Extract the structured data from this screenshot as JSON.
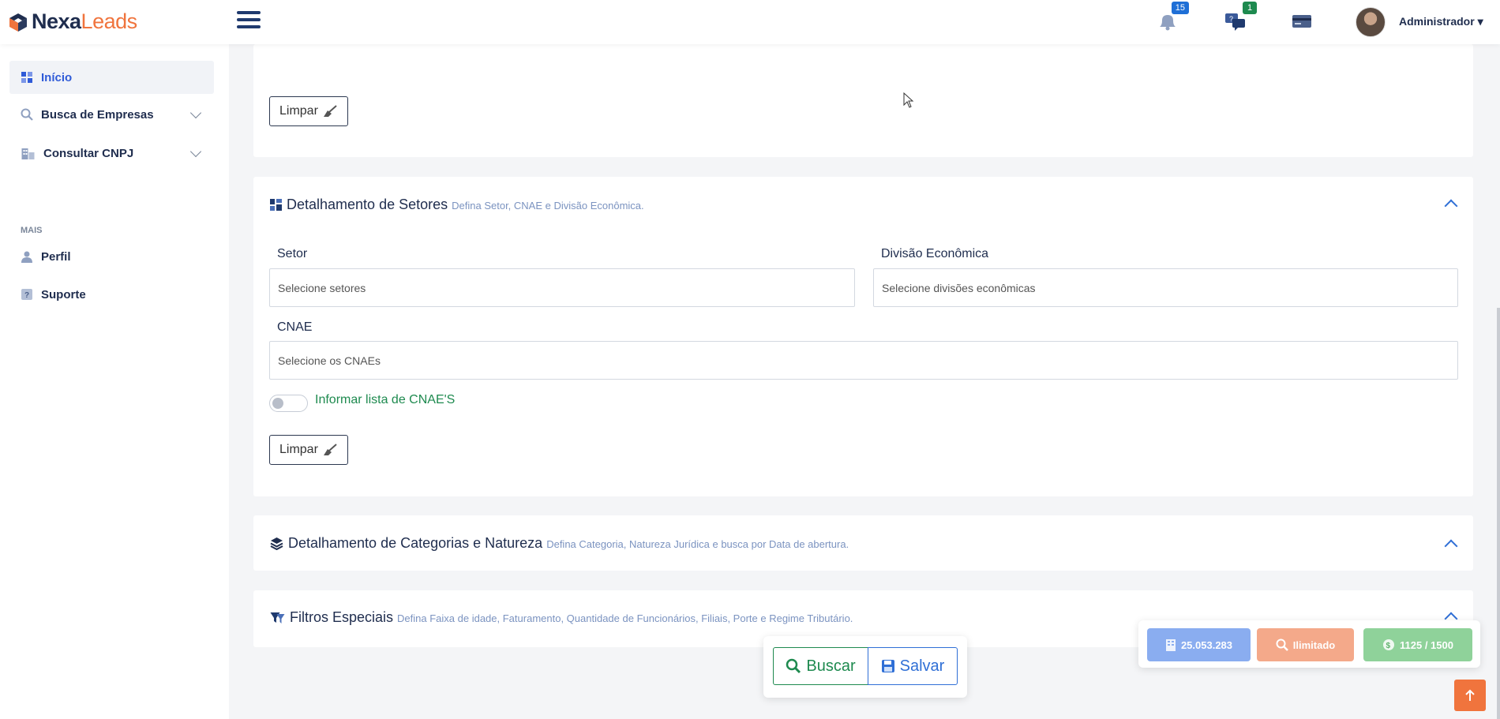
{
  "app": {
    "logo_a": "Nexa",
    "logo_b": "Leads"
  },
  "header": {
    "notifications_count": "15",
    "messages_count": "1",
    "user_name": "Administrador ▾"
  },
  "sidebar": {
    "items": [
      {
        "label": "Início",
        "icon": "dashboard-icon",
        "active": true
      },
      {
        "label": "Busca de Empresas",
        "icon": "search-icon",
        "expandable": true
      },
      {
        "label": "Consultar CNPJ",
        "icon": "building-icon",
        "expandable": true
      }
    ],
    "section": "MAIS",
    "extra_items": [
      {
        "label": "Perfil",
        "icon": "user-icon"
      },
      {
        "label": "Suporte",
        "icon": "help-icon"
      }
    ]
  },
  "top_card": {
    "clear_label": "Limpar"
  },
  "setores": {
    "title": "Detalhamento de Setores",
    "subtitle": "Defina Setor, CNAE e Divisão Econômica.",
    "setor_label": "Setor",
    "setor_placeholder": "Selecione setores",
    "divisao_label": "Divisão Econômica",
    "divisao_placeholder": "Selecione divisões econômicas",
    "cnae_label": "CNAE",
    "cnae_placeholder": "Selecione os CNAEs",
    "toggle_label": "Informar lista de CNAE'S",
    "toggle_on": false,
    "clear_label": "Limpar"
  },
  "categorias": {
    "title": "Detalhamento de Categorias e Natureza",
    "subtitle": "Defina Categoria, Natureza Jurídica e busca por Data de abertura."
  },
  "filtros": {
    "title": "Filtros Especiais",
    "subtitle": "Defina Faixa de idade, Faturamento, Quantidade de Funcionários, Filiais, Porte e Regime Tributário."
  },
  "actions": {
    "search_label": "Buscar",
    "save_label": "Salvar"
  },
  "stats": {
    "companies": "25.053.283",
    "searches": "Ilimitado",
    "credits": "1125 / 1500"
  },
  "colors": {
    "accent_blue": "#2f6fd6",
    "brand_orange": "#f0743d",
    "green": "#1e8a4f",
    "stat_blue": "#8aadf0",
    "stat_orange": "#f4a98a",
    "stat_green": "#8fd29a"
  }
}
